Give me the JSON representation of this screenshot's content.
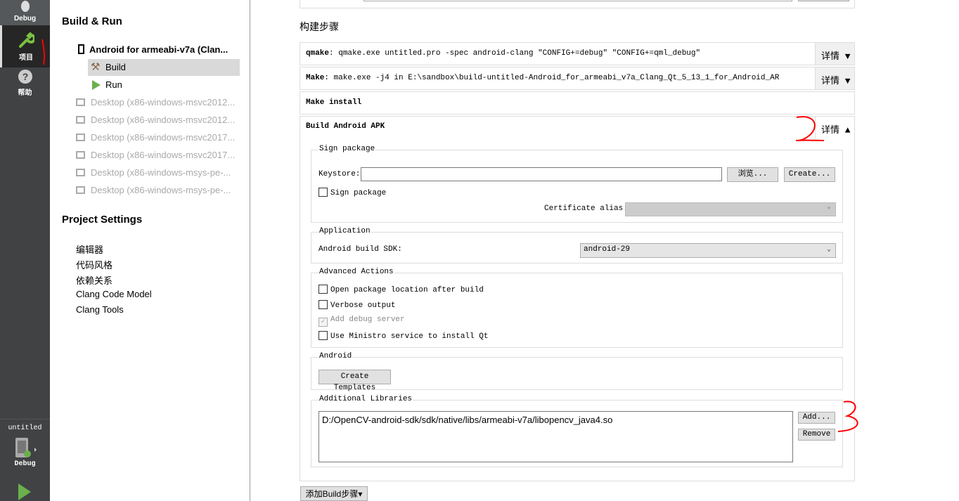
{
  "modebar": {
    "items": [
      {
        "label": "Debug",
        "icon": "bug-icon"
      },
      {
        "label": "项目",
        "icon": "wrench-icon",
        "active": true
      },
      {
        "label": "帮助",
        "icon": "help-icon"
      }
    ],
    "target": {
      "project": "untitled",
      "mode": "Debug"
    }
  },
  "nav": {
    "build_run_title": "Build & Run",
    "kit": "Android for armeabi-v7a (Clan...",
    "kit_items": [
      "Build",
      "Run"
    ],
    "other_kits": [
      "Desktop (x86-windows-msvc2012...",
      "Desktop (x86-windows-msvc2012...",
      "Desktop (x86-windows-msvc2017...",
      "Desktop (x86-windows-msvc2017...",
      "Desktop (x86-windows-msys-pe-...",
      "Desktop (x86-windows-msys-pe-..."
    ],
    "project_settings_title": "Project Settings",
    "settings": [
      "编辑器",
      "代码风格",
      "依赖关系",
      "Clang Code Model",
      "Clang Tools"
    ]
  },
  "main": {
    "section_title": "构建步骤",
    "steps": [
      {
        "name": "qmake",
        "detail": ": qmake.exe untitled.pro -spec android-clang \"CONFIG+=debug\" \"CONFIG+=qml_debug\"",
        "details_label": "详情 ▼"
      },
      {
        "name": "Make",
        "detail": ": make.exe -j4 in E:\\sandbox\\build-untitled-Android_for_armeabi_v7a_Clang_Qt_5_13_1_for_Android_AR",
        "details_label": "详情 ▼"
      },
      {
        "name": "Make install",
        "detail": ""
      },
      {
        "name": "Build Android APK",
        "detail": "",
        "details_label": "详情 ▲"
      }
    ],
    "sign": {
      "title": "Sign package",
      "keystore_label": "Keystore:",
      "keystore_value": "",
      "browse": "浏览...",
      "create": "Create...",
      "sign_checkbox": "Sign package",
      "cert_alias_label": "Certificate alias:"
    },
    "application": {
      "title": "Application",
      "sdk_label": "Android build SDK:",
      "sdk_value": "android-29"
    },
    "advanced": {
      "title": "Advanced Actions",
      "options": [
        {
          "label": "Open package location after build",
          "checked": false
        },
        {
          "label": "Verbose output",
          "checked": false
        },
        {
          "label": "Add debug server",
          "checked": true,
          "disabled": true
        },
        {
          "label": "Use Ministro service to install Qt",
          "checked": false
        }
      ]
    },
    "android": {
      "title": "Android",
      "create_templates": "Create Templates"
    },
    "libs": {
      "title": "Additional Libraries",
      "items": [
        "D:/OpenCV-android-sdk/sdk/native/libs/armeabi-v7a/libopencv_java4.so"
      ],
      "add": "Add...",
      "remove": "Remove"
    },
    "add_step": "添加Build步骤▾"
  },
  "colors": {
    "annotation": "#ff0000",
    "accent_green": "#6ab04c"
  }
}
